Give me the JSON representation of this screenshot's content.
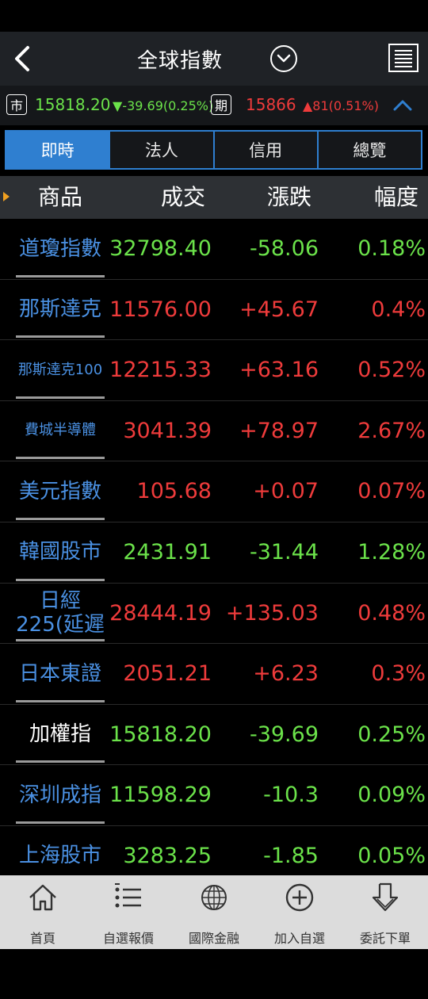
{
  "header": {
    "title": "全球指數"
  },
  "ticker": {
    "spot_tag": "市",
    "spot_price": "15818.20",
    "spot_change": "▼-39.69(0.25%)",
    "futures_tag": "期",
    "futures_price": "15866",
    "futures_change": "▲81(0.51%)"
  },
  "tabs": [
    {
      "label": "即時",
      "active": true
    },
    {
      "label": "法人",
      "active": false
    },
    {
      "label": "信用",
      "active": false
    },
    {
      "label": "總覽",
      "active": false
    }
  ],
  "columns": {
    "name": "商品",
    "price": "成交",
    "change": "漲跌",
    "percent": "幅度"
  },
  "rows": [
    {
      "name": "道瓊指數",
      "price": "32798.40",
      "change": "-58.06",
      "percent": "0.18%",
      "trend": "down"
    },
    {
      "name": "那斯達克",
      "price": "11576.00",
      "change": "+45.67",
      "percent": "0.4%",
      "trend": "up"
    },
    {
      "name": "那斯達克100",
      "price": "12215.33",
      "change": "+63.16",
      "percent": "0.52%",
      "trend": "up"
    },
    {
      "name": "費城半導體",
      "price": "3041.39",
      "change": "+78.97",
      "percent": "2.67%",
      "trend": "up"
    },
    {
      "name": "美元指數",
      "price": "105.68",
      "change": "+0.07",
      "percent": "0.07%",
      "trend": "up"
    },
    {
      "name": "韓國股市",
      "price": "2431.91",
      "change": "-31.44",
      "percent": "1.28%",
      "trend": "down"
    },
    {
      "name": "日經225(延遲",
      "price": "28444.19",
      "change": "+135.03",
      "percent": "0.48%",
      "trend": "up"
    },
    {
      "name": "日本東證",
      "price": "2051.21",
      "change": "+6.23",
      "percent": "0.3%",
      "trend": "up"
    },
    {
      "name": "加權指",
      "price": "15818.20",
      "change": "-39.69",
      "percent": "0.25%",
      "trend": "down"
    },
    {
      "name": "深圳成指",
      "price": "11598.29",
      "change": "-10.3",
      "percent": "0.09%",
      "trend": "down"
    },
    {
      "name": "上海股市",
      "price": "3283.25",
      "change": "-1.85",
      "percent": "0.05%",
      "trend": "down"
    }
  ],
  "bottom_nav": [
    {
      "label": "首頁",
      "icon": "home-icon"
    },
    {
      "label": "自選報價",
      "icon": "list-icon"
    },
    {
      "label": "國際金融",
      "icon": "globe-icon"
    },
    {
      "label": "加入自選",
      "icon": "plus-circle-icon"
    },
    {
      "label": "委託下單",
      "icon": "download-arrow-icon"
    }
  ],
  "colors": {
    "up": "#ee3b3b",
    "down": "#6be24a",
    "accent": "#2f7fd0",
    "name": "#4a90e2"
  }
}
